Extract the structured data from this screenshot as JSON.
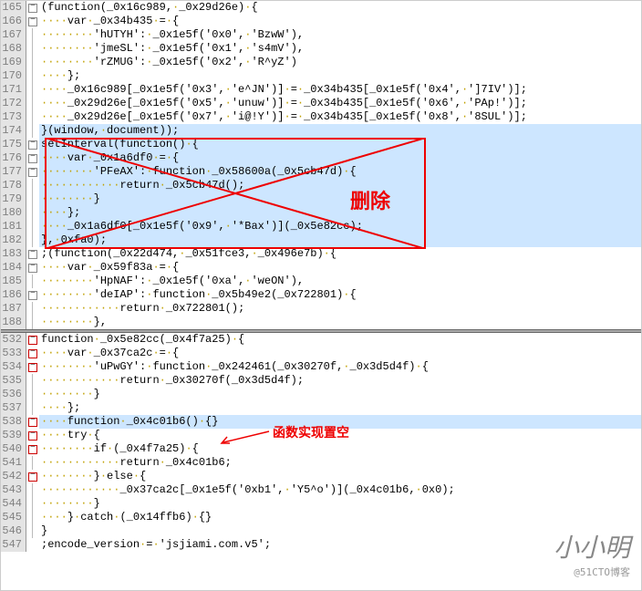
{
  "lines_top": [
    {
      "n": 165,
      "f": "minus",
      "c": "(<kw>function</kw>(_0x16c989,·_0x29d26e)·{"
    },
    {
      "n": 166,
      "f": "minus",
      "c": "····<kw>var</kw>·_0x34b435·=·{"
    },
    {
      "n": 167,
      "f": "line",
      "c": "········<str>'hUTYH'</str>:·_0x1e5f(<str>'0x0'</str>,·<str>'BzwW'</str>),"
    },
    {
      "n": 168,
      "f": "line",
      "c": "········<str>'jmeSL'</str>:·_0x1e5f(<str>'0x1'</str>,·<str>'s4mV'</str>),"
    },
    {
      "n": 169,
      "f": "line",
      "c": "········<str>'rZMUG'</str>:·_0x1e5f(<str>'0x2'</str>,·<str>'R^yZ'</str>)"
    },
    {
      "n": 170,
      "f": "line",
      "c": "····};"
    },
    {
      "n": 171,
      "f": "line",
      "c": "····_0x16c989[_0x1e5f(<str>'0x3'</str>,·<str>'e^JN'</str>)]·=·_0x34b435[_0x1e5f(<str>'0x4'</str>,·<str>']7IV'</str>)];"
    },
    {
      "n": 172,
      "f": "line",
      "c": "····_0x29d26e[_0x1e5f(<str>'0x5'</str>,·<str>'unuw'</str>)]·=·_0x34b435[_0x1e5f(<str>'0x6'</str>,·<str>'PAp!'</str>)];"
    },
    {
      "n": 173,
      "f": "line",
      "c": "····_0x29d26e[_0x1e5f(<str>'0x7'</str>,·<str>'i@!Y'</str>)]·=·_0x34b435[_0x1e5f(<str>'0x8'</str>,·<str>'8SUL'</str>)];"
    },
    {
      "n": 174,
      "f": "line",
      "c": "}(window,·document));"
    }
  ],
  "lines_sel": [
    {
      "n": 175,
      "f": "minus",
      "c": "<sel>setInterval(</sel><kw>function</kw><sel>()·{</sel>"
    },
    {
      "n": 176,
      "f": "minus",
      "c": "····<sel><kw>var</kw>·_0x1a6df0·=·{</sel>"
    },
    {
      "n": 177,
      "f": "minus",
      "c": "········<sel><str>'PFeAX'</str>:·</sel><kw>function</kw><sel>·_0x58600a(_0x5cb47d)·{</sel>"
    },
    {
      "n": 178,
      "f": "line",
      "c": "············<sel><kw>return</kw>·_0x5cb47d();</sel>"
    },
    {
      "n": 179,
      "f": "line",
      "c": "········<sel>}</sel>"
    },
    {
      "n": 180,
      "f": "line",
      "c": "····<sel>};</sel>"
    },
    {
      "n": 181,
      "f": "line",
      "c": "····<sel>_0x1a6df0[_0x1e5f(<str>'0x9'</str>,·<str>'*Bax'</str>)](_0x5e82cc);</sel>"
    },
    {
      "n": 182,
      "f": "line",
      "c": "<sel>},·<num>0xfa0</num>);</sel>"
    }
  ],
  "lines_mid": [
    {
      "n": 183,
      "f": "minus",
      "c": ";(<kw>function</kw>(_0x22d474,·_0x51fce3,·_0x496e7b)·{"
    },
    {
      "n": 184,
      "f": "minus",
      "c": "····<kw>var</kw>·_0x59f83a·=·{"
    },
    {
      "n": 185,
      "f": "line",
      "c": "········<str>'HpNAF'</str>:·_0x1e5f(<str>'0xa'</str>,·<str>'weON'</str>),"
    },
    {
      "n": 186,
      "f": "minus",
      "c": "········<str>'deIAP'</str>:·<kw>function</kw>·_0x5b49e2(_0x722801)·{"
    },
    {
      "n": 187,
      "f": "line",
      "c": "············<kw>return</kw>·_0x722801();"
    },
    {
      "n": 188,
      "f": "line",
      "c": "········},"
    }
  ],
  "lines_bot": [
    {
      "n": 532,
      "f": "minus",
      "c": "<kw>function</kw>·_0x5e82cc(_0x4f7a25)·{",
      "red": true
    },
    {
      "n": 533,
      "f": "minus",
      "c": "····<kw>var</kw>·_0x37ca2c·=·{",
      "red": true
    },
    {
      "n": 534,
      "f": "minus",
      "c": "········<str>'uPwGY'</str>:·<kw>function</kw>·_0x242461(_0x30270f,·_0x3d5d4f)·{",
      "red": true
    },
    {
      "n": 535,
      "f": "line",
      "c": "············<kw>return</kw>·_0x30270f(_0x3d5d4f);",
      "red": true
    },
    {
      "n": 536,
      "f": "line",
      "c": "········}",
      "red": true
    },
    {
      "n": 537,
      "f": "line",
      "c": "····};",
      "red": true
    },
    {
      "n": 538,
      "f": "minus",
      "c": "····<kw>function</kw>·_0x4c01b6()·<hl>{}</hl>",
      "red": true
    },
    {
      "n": 539,
      "f": "minus",
      "c": "····<kw>try</kw>·{",
      "red": true
    },
    {
      "n": 540,
      "f": "minus",
      "c": "········<kw>if</kw>·(_0x4f7a25)·{",
      "red": true
    },
    {
      "n": 541,
      "f": "line",
      "c": "············<kw>return</kw>·_0x4c01b6;",
      "red": true
    },
    {
      "n": 542,
      "f": "minus",
      "c": "········}·<kw>else</kw>·{",
      "red": true
    },
    {
      "n": 543,
      "f": "line",
      "c": "············_0x37ca2c[_0x1e5f(<str>'0xb1'</str>,·<str>'Y5^o'</str>)](_0x4c01b6,·<num>0x0</num>);",
      "red": true
    },
    {
      "n": 544,
      "f": "line",
      "c": "········}",
      "red": true
    },
    {
      "n": 545,
      "f": "line",
      "c": "····}·<kw>catch</kw>·(_0x14ffb6)·{}",
      "red": true
    },
    {
      "n": 546,
      "f": "line",
      "c": "}",
      "red": true
    },
    {
      "n": 547,
      "f": "",
      "c": ";encode_version·=·<str>'jsjiami.com.v5'</str>;"
    }
  ],
  "annotations": {
    "delete": "删除",
    "empty_fn": "函数实现置空"
  },
  "watermark": {
    "name": "小小明",
    "handle": "@51CTO博客"
  }
}
